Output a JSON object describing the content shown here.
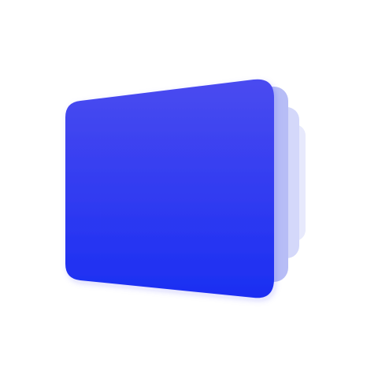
{
  "icon": {
    "name": "stacked-cards-logo-icon",
    "colors": {
      "background": "#ffffff",
      "front_top": "#4a4bf0",
      "front_bottom": "#1b2ef2",
      "layer_2": "#b7bdf6",
      "layer_3": "#d4d8fa",
      "layer_4": "#e7e9fc"
    }
  }
}
